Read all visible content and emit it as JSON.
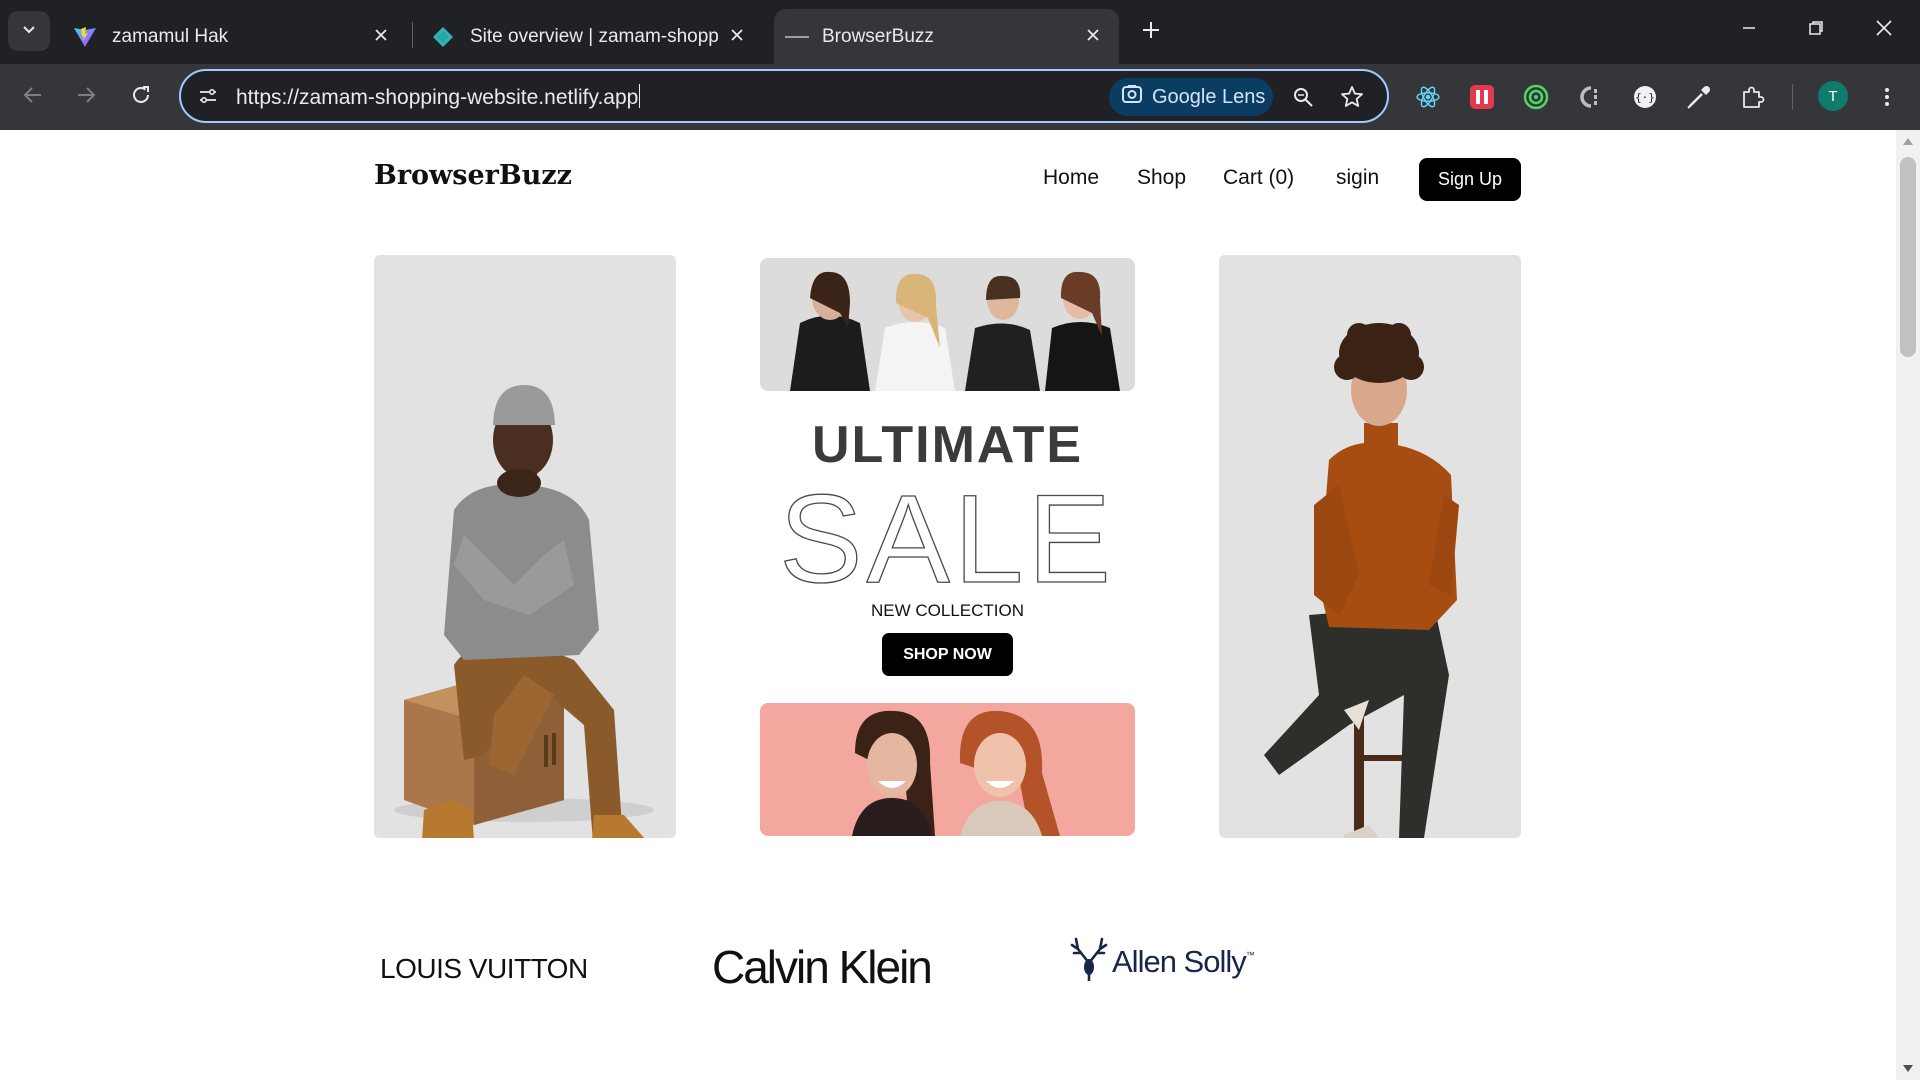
{
  "browser": {
    "tabs": [
      {
        "title": "zamamul Hak",
        "icon": "vite-logo-icon",
        "active": false
      },
      {
        "title": "Site overview | zamam-shopping",
        "icon": "netlify-logo-icon",
        "active": false
      },
      {
        "title": "BrowserBuzz",
        "icon": "site-favicon-icon",
        "active": true
      }
    ],
    "url": "https://zamam-shopping-website.netlify.app",
    "lens_label": "Google Lens",
    "profile_initial": "T",
    "colors": {
      "chrome_dark": "#202124",
      "chrome_toolbar": "#35363a",
      "omnibox_focus": "#a8c7fa",
      "lens_bg": "#0b3d63"
    }
  },
  "site": {
    "brand": "BrowserBuzz",
    "nav": {
      "home": "Home",
      "shop": "Shop",
      "cart": "Cart (0)",
      "signin": "sigin",
      "signup": "Sign Up"
    },
    "hero": {
      "ultimate": "ULTIMATE",
      "sale": "SALE",
      "collection": "NEW COLLECTION",
      "cta": "SHOP NOW"
    },
    "brands": [
      "LOUIS VUITTON",
      "Calvin Klein",
      "Allen Solly"
    ],
    "brand_trademark": "™"
  }
}
